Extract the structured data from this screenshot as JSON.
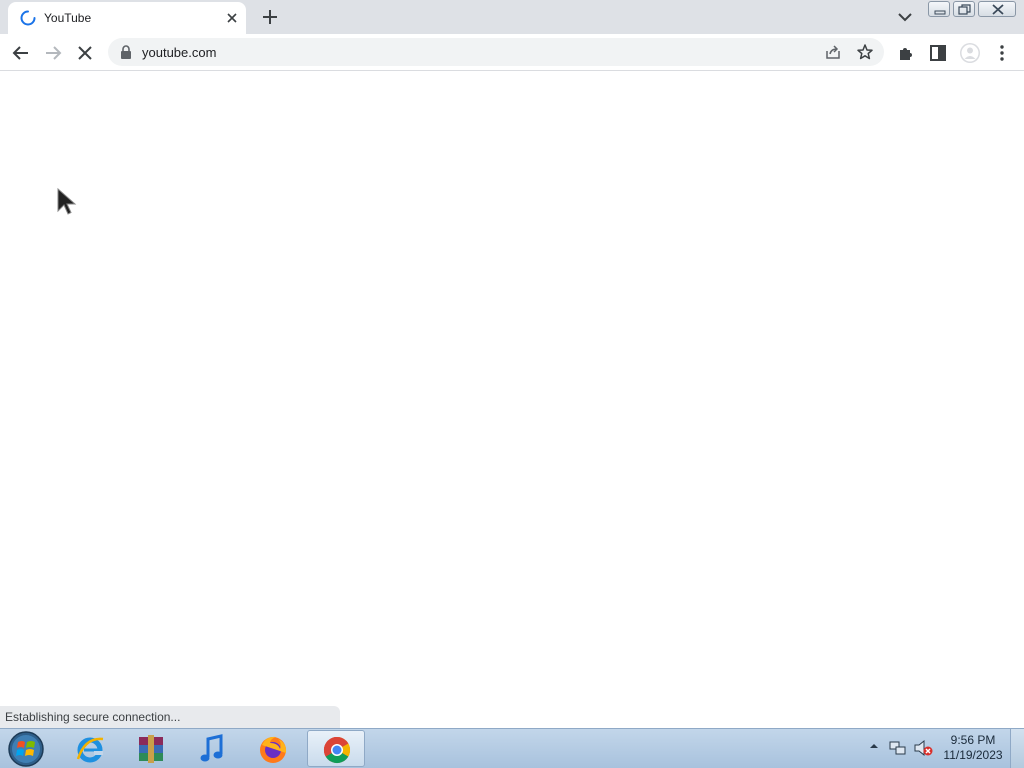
{
  "browser": {
    "tab": {
      "title": "YouTube",
      "state": "loading"
    },
    "address_bar": {
      "url": "youtube.com",
      "secure": true
    },
    "status_text": "Establishing secure connection..."
  },
  "taskbar": {
    "pinned_apps": [
      "start-button",
      "internet-explorer",
      "winrar",
      "itunes",
      "firefox",
      "chrome"
    ],
    "active_app": "chrome",
    "clock": {
      "time": "9:56 PM",
      "date": "11/19/2023"
    }
  },
  "colors": {
    "accent": "#1a73e8",
    "tabstrip": "#dee1e6",
    "omnibox": "#f1f3f4"
  }
}
